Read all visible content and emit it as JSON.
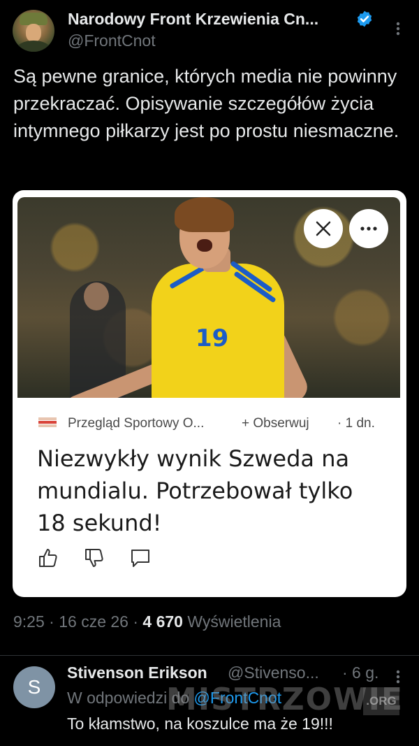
{
  "tweet": {
    "display_name": "Narodowy Front Krzewienia Cn...",
    "handle": "@FrontCnot",
    "verified": true,
    "text": "Są pewne granice, których media nie powinny przekraczać. Opisywanie szczegółów życia intymnego piłkarzy jest po prostu niesmaczne.",
    "time": "9:25",
    "date": "16 cze 26",
    "views_count": "4 670",
    "views_label": "Wyświetlenia",
    "separator": "·"
  },
  "card": {
    "image_alt_jersey_number": "19",
    "close_icon": "close-icon",
    "more_icon": "more-horizontal-icon",
    "source_name": "Przegląd Sportowy O...",
    "follow_label": "+ Obserwuj",
    "time_ago": "· 1 dn.",
    "headline": "Niezwykły wynik Szweda na mundialu. Potrzebował tylko 18 sekund!",
    "reactions": [
      "thumbs-up-icon",
      "thumbs-down-icon",
      "comment-icon"
    ]
  },
  "reply": {
    "avatar_letter": "S",
    "display_name": "Stivenson Erikson",
    "handle": "@Stivenso...",
    "time": "· 6 g.",
    "reply_to_prefix": "W odpowiedzi do",
    "reply_to_handle": "@FrontCnot",
    "text": "To kłamstwo, na koszulce ma że 19!!!"
  },
  "watermark": {
    "text": "MISTRZOWIE",
    "suffix": ".ORG"
  },
  "colors": {
    "background": "#000000",
    "text_primary": "#e7e9ea",
    "text_secondary": "#71767b",
    "link": "#1d9bf0",
    "verified": "#1d9bf0",
    "jersey_yellow": "#f2d21a",
    "jersey_blue": "#1b5cc7"
  }
}
